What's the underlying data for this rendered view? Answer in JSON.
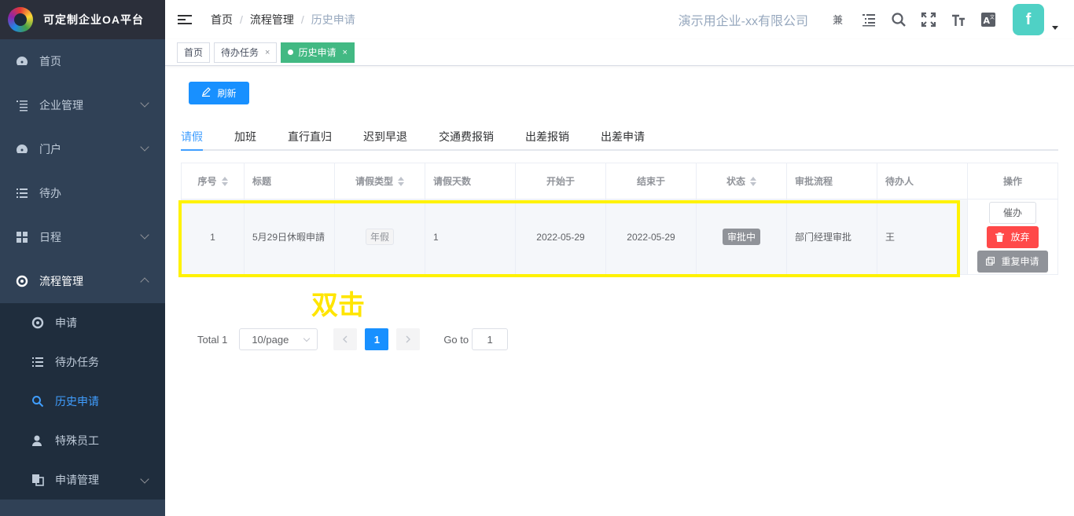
{
  "app": {
    "title": "可定制企业OA平台"
  },
  "sidebar": {
    "items": [
      {
        "label": "首页",
        "icon": "dashboard-icon"
      },
      {
        "label": "企业管理",
        "icon": "tree-list-icon"
      },
      {
        "label": "门户",
        "icon": "dashboard-icon"
      },
      {
        "label": "待办",
        "icon": "list-icon"
      },
      {
        "label": "日程",
        "icon": "grid-icon"
      },
      {
        "label": "流程管理",
        "icon": "flow-icon"
      }
    ],
    "subitems": [
      {
        "label": "申请",
        "icon": "flow-icon"
      },
      {
        "label": "待办任务",
        "icon": "list-icon"
      },
      {
        "label": "历史申请",
        "icon": "search-icon"
      },
      {
        "label": "特殊员工",
        "icon": "user-icon"
      },
      {
        "label": "申请管理",
        "icon": "copy-icon"
      }
    ]
  },
  "header": {
    "breadcrumb": [
      "首页",
      "流程管理",
      "历史申请"
    ],
    "separator": "/",
    "company": "演示用企业-xx有限公司",
    "avatar_text": "f"
  },
  "tags": [
    {
      "label": "首页"
    },
    {
      "label": "待办任务",
      "close": "×"
    },
    {
      "label": "历史申请",
      "close": "×"
    }
  ],
  "main": {
    "refresh_label": "刷新",
    "tabs": [
      "请假",
      "加班",
      "直行直归",
      "迟到早退",
      "交通费报销",
      "出差报销",
      "出差申请"
    ],
    "columns": [
      "序号",
      "标题",
      "请假类型",
      "请假天数",
      "开始于",
      "结束于",
      "状态",
      "审批流程",
      "待办人",
      "操作"
    ],
    "rows": [
      {
        "index": "1",
        "title": "5月29日休暇申請",
        "type": "年假",
        "days": "1",
        "start": "2022-05-29",
        "end": "2022-05-29",
        "status": "审批中",
        "flow": "部门经理审批",
        "assignee": "王",
        "actions": {
          "urge": "催办",
          "abandon": "放弃",
          "reapply": "重复申请"
        }
      }
    ],
    "annotation": "双击"
  },
  "pagination": {
    "total": "Total 1",
    "page_size": "10/page",
    "current_page": "1",
    "goto_label": "Go to",
    "goto_value": "1"
  },
  "colors": {
    "sidebar_bg": "#304156",
    "primary": "#1890ff",
    "tag_active": "#42b983",
    "highlight": "#fff200",
    "danger": "#ff4949"
  }
}
